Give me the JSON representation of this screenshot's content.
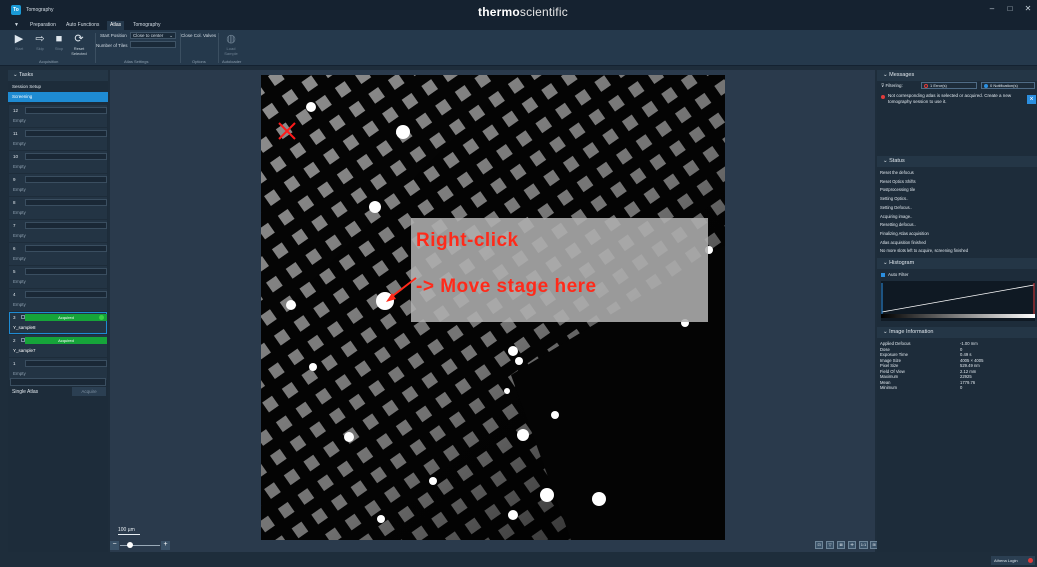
{
  "window": {
    "app_title": "Tomography",
    "logo_text": "To",
    "brand_bold": "thermo",
    "brand_light": "scientific",
    "controls": {
      "minimize": "–",
      "maximize": "□",
      "close": "✕"
    }
  },
  "ribbon": {
    "file_arrow": "▼",
    "tabs": [
      "Preparation",
      "Auto Functions",
      "Atlas",
      "Tomography"
    ],
    "active_tab": "Atlas",
    "buttons": {
      "start": "Start",
      "skip": "Skip",
      "stop": "Stop",
      "reset_line1": "Reset",
      "reset_line2": "Selected",
      "load_line1": "Load",
      "load_line2": "Sample"
    },
    "start_position_label": "Start Position",
    "start_position_value": "Close to center",
    "close_col_values_label": "Close Col. Valves",
    "number_of_tiles_label": "Number of Tiles",
    "groups": [
      "Acquisition",
      "Atlas Settings",
      "Options",
      "Autoloader"
    ]
  },
  "tasks": {
    "header": "Tasks",
    "rows": [
      "Session Setup",
      "Screening"
    ],
    "slots": [
      {
        "num": "12",
        "name": "Empty",
        "acquired": false
      },
      {
        "num": "11",
        "name": "Empty",
        "acquired": false
      },
      {
        "num": "10",
        "name": "Empty",
        "acquired": false
      },
      {
        "num": "9",
        "name": "Empty",
        "acquired": false
      },
      {
        "num": "8",
        "name": "Empty",
        "acquired": false
      },
      {
        "num": "7",
        "name": "Empty",
        "acquired": false
      },
      {
        "num": "6",
        "name": "Empty",
        "acquired": false
      },
      {
        "num": "5",
        "name": "Empty",
        "acquired": false
      },
      {
        "num": "4",
        "name": "Empty",
        "acquired": false
      },
      {
        "num": "3",
        "name": "Y_sample8",
        "acquired": true,
        "status": "Acquired"
      },
      {
        "num": "2",
        "name": "Y_sample7",
        "acquired": true,
        "status": "Acquired"
      },
      {
        "num": "1",
        "name": "Empty",
        "acquired": false
      }
    ],
    "single_atlas": "Single Atlas",
    "acquire_button": "Acquire"
  },
  "viewer": {
    "scalebar": "100 µm",
    "callout_line1": "Right-click",
    "callout_line2": "-> Move stage here",
    "zoom_minus": "−",
    "zoom_plus": "+",
    "zoom_level": 0.25,
    "view_controls": [
      "⊡",
      "▽",
      "⊠",
      "✛",
      "1:1",
      "⊞"
    ],
    "callout_color": "#ff2a1a"
  },
  "messages": {
    "header": "Messages",
    "filtering_label": "Filtering:",
    "errors_pill": "1 Error(s)",
    "notifications_pill": "0 Notification(s)",
    "message_text": "Not corresponding atlas is selected or acquired. Create a new tomography session to use it."
  },
  "status": {
    "header": "Status",
    "items": [
      "Reset the defocus",
      "Reset Optics Shifts",
      "Postprocessing tile",
      "Setting Optics..",
      "Setting Defocus..",
      "Acquiring image..",
      "Resetting defocus..",
      "Finalizing Atlas acquisition",
      "Atlas acquisition finished",
      "No more slots left to acquire, screening finished"
    ]
  },
  "histogram": {
    "header": "Histogram",
    "auto_filter": "Auto Filter"
  },
  "image_information": {
    "header": "Image Information",
    "rows": [
      {
        "k": "Applied Defocus",
        "v": "-1.00 mm"
      },
      {
        "k": "Dose",
        "v": "0"
      },
      {
        "k": "Exposure Time",
        "v": "0.49 s"
      },
      {
        "k": "Image Size",
        "v": "4005 × 4005"
      },
      {
        "k": "Pixel Size",
        "v": "529.49 nm"
      },
      {
        "k": "Field Of View",
        "v": "2.12 mm"
      },
      {
        "k": "Maximum",
        "v": "22925"
      },
      {
        "k": "Mean",
        "v": "1779.76"
      },
      {
        "k": "Minimum",
        "v": "0"
      }
    ]
  },
  "footer": {
    "athena_login": "Athena Login"
  }
}
